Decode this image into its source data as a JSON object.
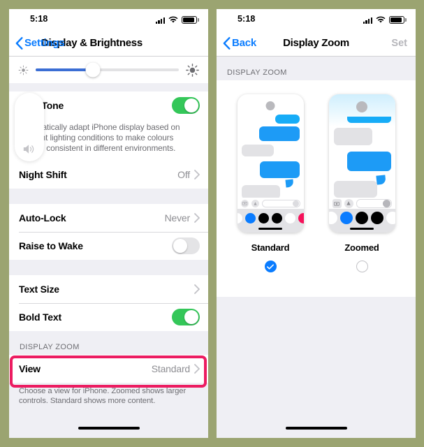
{
  "background_color": "#9ba471",
  "accent_blue": "#0a7cff",
  "highlight_color": "#ec1c61",
  "toggle_on_color": "#34c759",
  "left_phone": {
    "status_bar": {
      "time": "5:18",
      "signal_icon": "cellular-signal-icon",
      "wifi_icon": "wifi-icon",
      "battery_icon": "battery-icon"
    },
    "nav": {
      "back_label": "Settings",
      "title": "Display & Brightness"
    },
    "brightness": {
      "low_icon": "brightness-low-icon",
      "high_icon": "brightness-high-icon",
      "value_percent": 40
    },
    "rows": {
      "true_tone": {
        "label": "True Tone",
        "toggle": "on"
      },
      "true_tone_desc": "Automatically adapt iPhone display based on ambient lighting conditions to make colours appear consistent in different environments.",
      "night_shift": {
        "label": "Night Shift",
        "value": "Off"
      },
      "auto_lock": {
        "label": "Auto-Lock",
        "value": "Never"
      },
      "raise_to_wake": {
        "label": "Raise to Wake",
        "toggle": "off"
      },
      "text_size": {
        "label": "Text Size",
        "value": ""
      },
      "bold_text": {
        "label": "Bold Text",
        "toggle": "on"
      }
    },
    "display_zoom_section": {
      "header": "DISPLAY ZOOM",
      "view_row": {
        "label": "View",
        "value": "Standard"
      },
      "footnote": "Choose a view for iPhone. Zoomed shows larger controls. Standard shows more content."
    },
    "volume_hud": {
      "icon": "speaker-volume-icon"
    }
  },
  "right_phone": {
    "status_bar": {
      "time": "5:18",
      "signal_icon": "cellular-signal-icon",
      "wifi_icon": "wifi-icon",
      "battery_icon": "battery-icon"
    },
    "nav": {
      "back_label": "Back",
      "title": "Display Zoom",
      "action_label": "Set"
    },
    "section_header": "DISPLAY ZOOM",
    "options": [
      {
        "label": "Standard",
        "selected": true,
        "preview": "standard-messages-preview"
      },
      {
        "label": "Zoomed",
        "selected": false,
        "preview": "zoomed-messages-preview"
      }
    ]
  }
}
